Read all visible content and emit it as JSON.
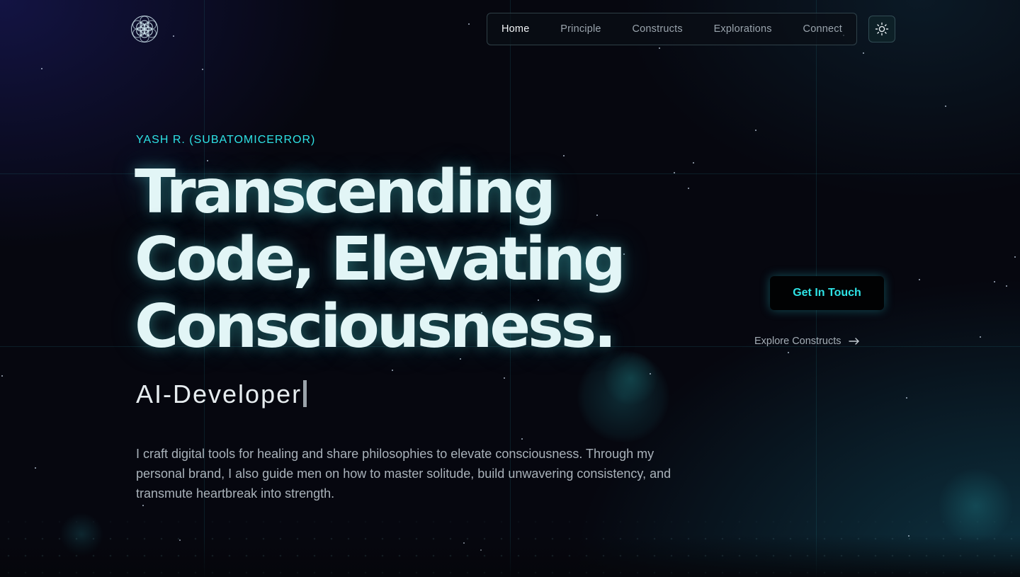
{
  "brand": {
    "logo_icon": "flower-of-life-icon"
  },
  "nav": {
    "items": [
      {
        "label": "Home",
        "active": true
      },
      {
        "label": "Principle",
        "active": false
      },
      {
        "label": "Constructs",
        "active": false
      },
      {
        "label": "Explorations",
        "active": false
      },
      {
        "label": "Connect",
        "active": false
      }
    ],
    "theme_toggle_icon": "sun-icon"
  },
  "hero": {
    "eyebrow": "YASH R. (SUBATOMICERROR)",
    "headline_lines": [
      "Transcending",
      "Code, Elevating",
      "Consciousness."
    ],
    "role": "AI-Developer",
    "description": "I craft digital tools for healing and share philosophies to elevate consciousness. Through my personal brand, I also guide men on how to master solitude, build unwavering consistency, and transmute heartbreak into strength."
  },
  "actions": {
    "primary_label": "Get In Touch",
    "secondary_label": "Explore Constructs",
    "secondary_icon": "arrow-right-icon"
  },
  "colors": {
    "accent": "#2ee3e6",
    "background": "#06070f",
    "headline": "#e2f5f6",
    "muted_text": "#a9b2ba"
  }
}
